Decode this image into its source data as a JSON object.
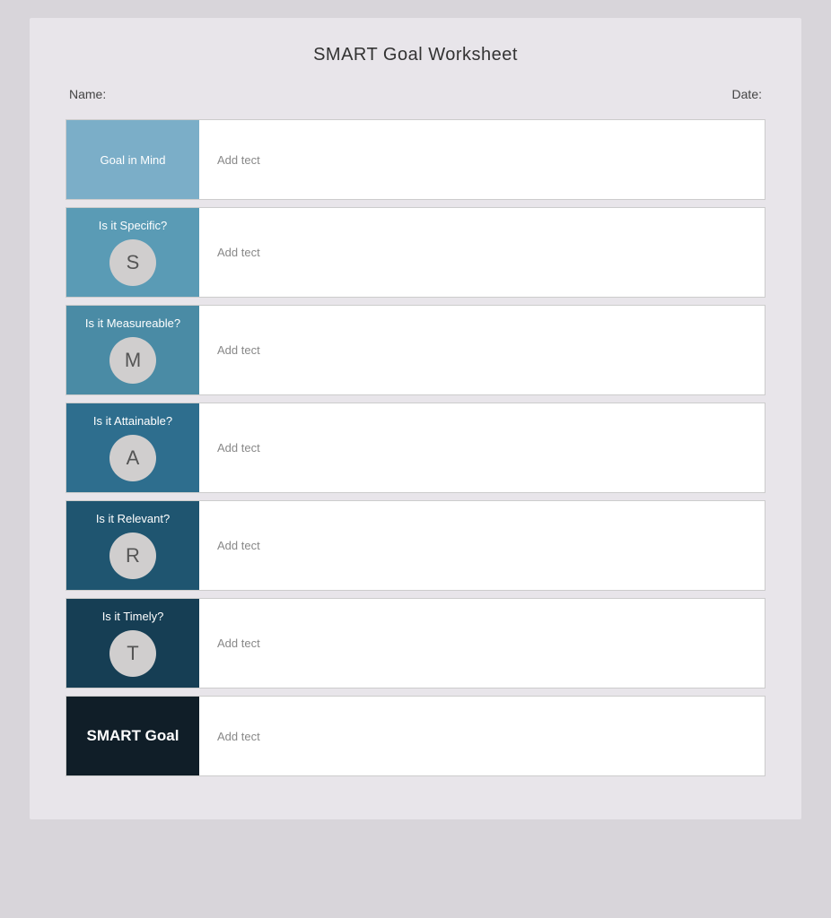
{
  "title": "SMART Goal Worksheet",
  "header": {
    "name_label": "Name:",
    "date_label": "Date:"
  },
  "rows": [
    {
      "id": "goal-in-mind",
      "label": "Goal in Mind",
      "bg_class": "bg-light-blue",
      "has_circle": false,
      "letter": "",
      "placeholder": "Add tect"
    },
    {
      "id": "specific",
      "label": "Is it Specific?",
      "bg_class": "bg-medium-blue",
      "has_circle": true,
      "letter": "S",
      "placeholder": "Add tect"
    },
    {
      "id": "measurable",
      "label": "Is it Measureable?",
      "bg_class": "bg-mid-blue",
      "has_circle": true,
      "letter": "M",
      "placeholder": "Add tect"
    },
    {
      "id": "attainable",
      "label": "Is it Attainable?",
      "bg_class": "bg-teal",
      "has_circle": true,
      "letter": "A",
      "placeholder": "Add tect"
    },
    {
      "id": "relevant",
      "label": "Is it Relevant?",
      "bg_class": "bg-dark-teal",
      "has_circle": true,
      "letter": "R",
      "placeholder": "Add tect"
    },
    {
      "id": "timely",
      "label": "Is it Timely?",
      "bg_class": "bg-darker-teal",
      "has_circle": true,
      "letter": "T",
      "placeholder": "Add tect"
    },
    {
      "id": "smart-goal",
      "label": "SMART Goal",
      "bg_class": "bg-darkest",
      "has_circle": false,
      "letter": "",
      "placeholder": "Add tect",
      "is_smart": true
    }
  ]
}
